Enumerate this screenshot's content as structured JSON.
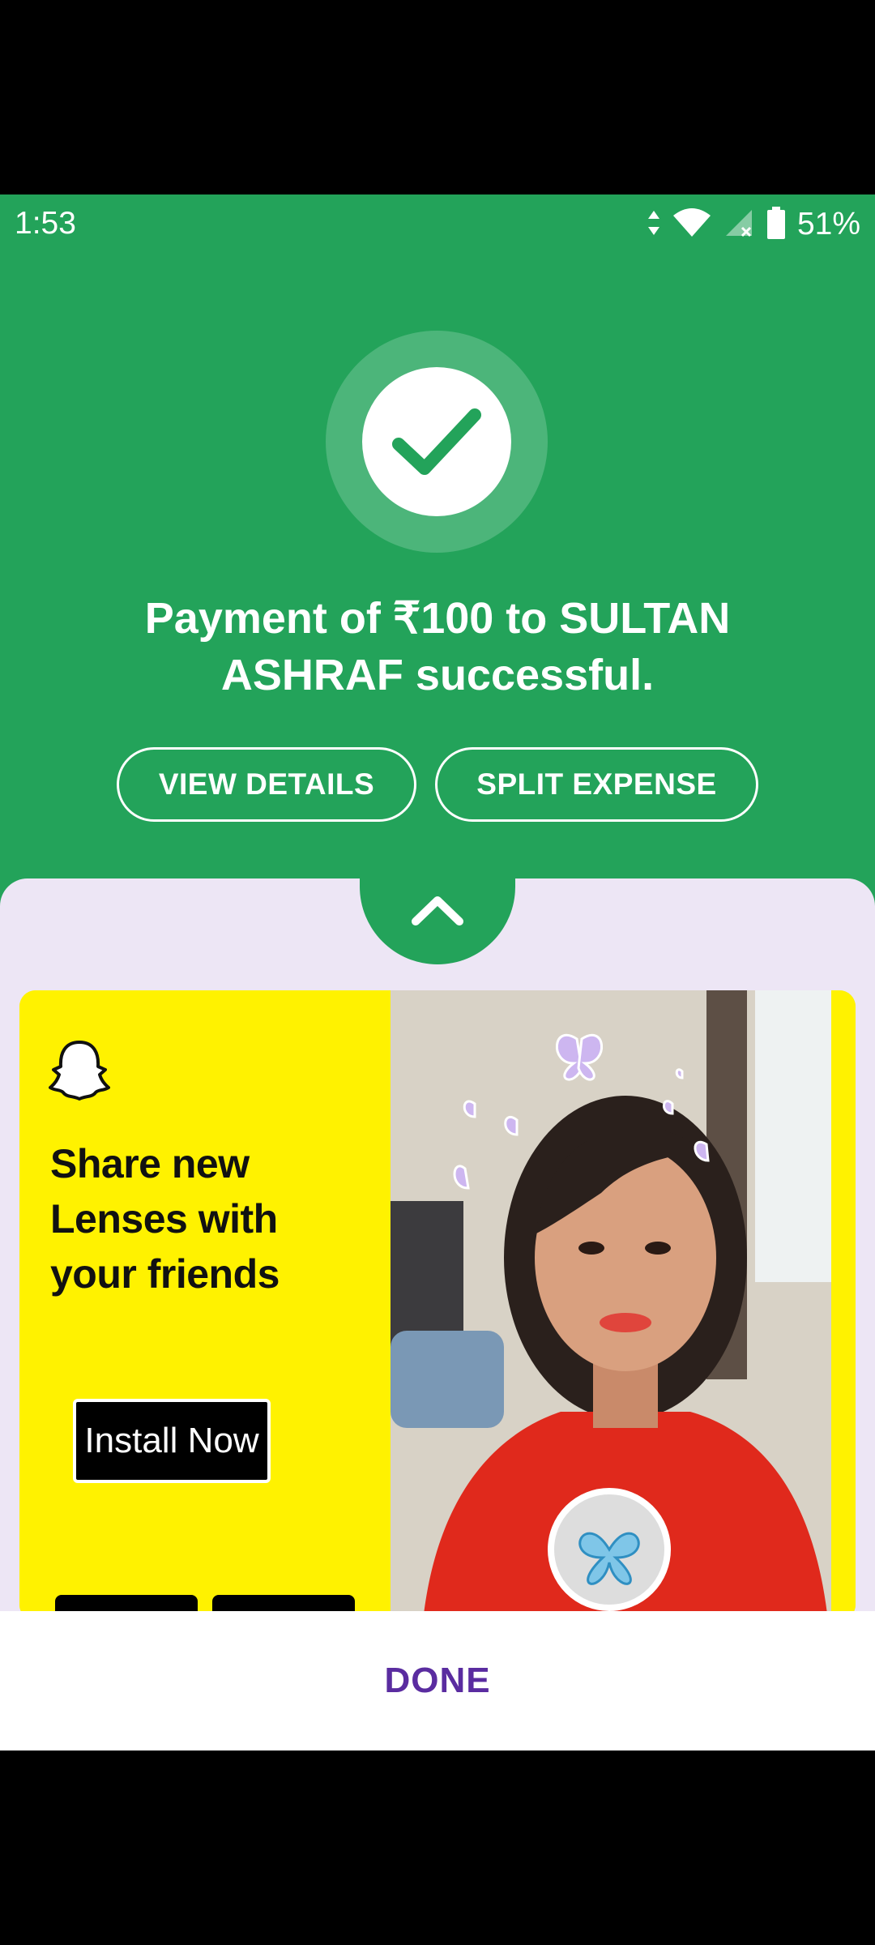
{
  "status_bar": {
    "time": "1:53",
    "battery_percent": "51%",
    "icons": [
      "data-arrows-icon",
      "wifi-icon",
      "cellular-no-signal-icon",
      "battery-icon"
    ]
  },
  "payment": {
    "status_icon": "check-icon",
    "message": "Payment of ₹100 to SULTAN ASHRAF successful.",
    "view_details_label": "VIEW DETAILS",
    "split_expense_label": "SPLIT EXPENSE"
  },
  "sheet": {
    "expand_icon": "chevron-up-icon"
  },
  "ad": {
    "brand_icon": "snapchat-ghost-icon",
    "headline": "Share new Lenses with your friends",
    "cta_label": "Install Now",
    "store_badges": [
      "google-play-badge",
      "app-store-badge"
    ]
  },
  "footer": {
    "done_label": "DONE"
  },
  "colors": {
    "primary_green": "#23a35a",
    "sheet_background": "#ede6f5",
    "ad_yellow": "#fff200",
    "done_purple": "#5a2ca0"
  }
}
